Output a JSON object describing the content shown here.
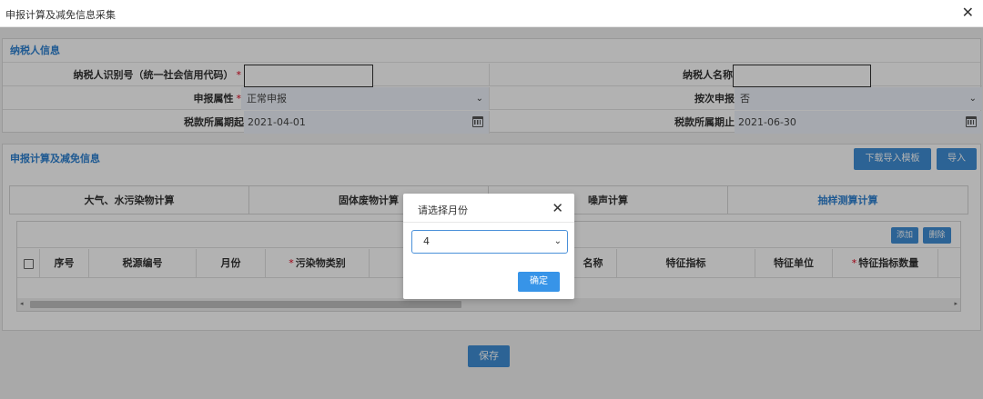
{
  "window": {
    "title": "申报计算及减免信息采集",
    "close_glyph": "✕"
  },
  "taxpayer": {
    "section_title": "纳税人信息",
    "id_label": "纳税人识别号（统一社会信用代码）",
    "id_value": "",
    "name_label": "纳税人名称",
    "name_value": "",
    "attr_label": "申报属性",
    "attr_value": "正常申报",
    "by_label": "按次申报",
    "by_value": "否",
    "start_label": "税款所属期起",
    "start_value": "2021-04-01",
    "end_label": "税款所属期止",
    "end_value": "2021-06-30",
    "required_mark": "*"
  },
  "calc": {
    "section_title": "申报计算及减免信息",
    "download_template_label": "下载导入模板",
    "import_label": "导入",
    "tabs": [
      {
        "label": "大气、水污染物计算"
      },
      {
        "label": "固体废物计算"
      },
      {
        "label": "噪声计算"
      },
      {
        "label": "抽样测算计算"
      }
    ],
    "toolbar": {
      "add_label": "添加",
      "delete_label": "删除"
    },
    "columns": [
      "序号",
      "税源编号",
      "月份",
      "污染物类别",
      "污染物名称",
      "特征指标",
      "特征单位",
      "特征指标数量"
    ],
    "partial_column": "名称",
    "required_mark": "*"
  },
  "save_label": "保存",
  "modal": {
    "title": "请选择月份",
    "close_glyph": "✕",
    "selected_month": "4",
    "ok_label": "确定"
  },
  "icons": {
    "chevron": "⌄",
    "scroll_left": "◂",
    "scroll_right": "▸"
  },
  "colors": {
    "accent": "#2e82d1",
    "button": "#3f8fd6",
    "required": "#e0001b"
  }
}
